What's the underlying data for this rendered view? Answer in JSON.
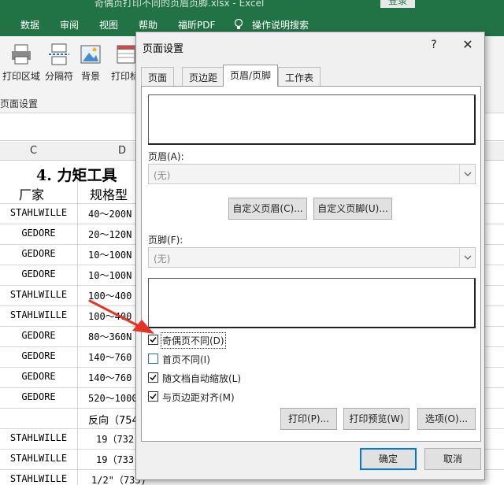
{
  "window": {
    "title": "奇偶页打印不同的页眉页脚.xlsx  -  Excel",
    "login": "登录"
  },
  "ribbon_tabs": [
    "数据",
    "审阅",
    "视图",
    "帮助",
    "福昕PDF",
    "操作说明搜索"
  ],
  "ribbon_buttons": [
    "打印区域",
    "分隔符",
    "背景",
    "打印标"
  ],
  "ribbon_group_label": "页面设置",
  "columns": [
    "C",
    "D"
  ],
  "sheet": {
    "title": "4. 力矩工具",
    "header_c": "厂家",
    "header_d": "规格型",
    "rows": [
      {
        "c": "STAHLWILLE",
        "d": "40～200N"
      },
      {
        "c": "GEDORE",
        "d": "20～120N"
      },
      {
        "c": "GEDORE",
        "d": "10～100N"
      },
      {
        "c": "GEDORE",
        "d": "10～100N"
      },
      {
        "c": "STAHLWILLE",
        "d": "100～400"
      },
      {
        "c": "STAHLWILLE",
        "d": "100～400"
      },
      {
        "c": "GEDORE",
        "d": "80～360N"
      },
      {
        "c": "GEDORE",
        "d": "140～760"
      },
      {
        "c": "GEDORE",
        "d": "140～760"
      },
      {
        "c": "GEDORE",
        "d": "520～1000"
      },
      {
        "c": "",
        "d": "反向（754"
      },
      {
        "c": "STAHLWILLE",
        "d": "19（732"
      },
      {
        "c": "STAHLWILLE",
        "d": "19（733"
      },
      {
        "c": "STAHLWILLE",
        "d": "1/2\"（735)"
      }
    ]
  },
  "dialog": {
    "title": "页面设置",
    "help": "?",
    "close": "✕",
    "tabs": [
      "页面",
      "页边距",
      "页眉/页脚",
      "工作表"
    ],
    "active_tab": "页眉/页脚",
    "header_label": "页眉(A):",
    "header_value": "(无)",
    "custom_header": "自定义页眉(C)...",
    "custom_footer": "自定义页脚(U)...",
    "footer_label": "页脚(F):",
    "footer_value": "(无)",
    "checkboxes": [
      {
        "label": "奇偶页不同(D)",
        "checked": true
      },
      {
        "label": "首页不同(I)",
        "checked": false
      },
      {
        "label": "随文档自动缩放(L)",
        "checked": true
      },
      {
        "label": "与页边距对齐(M)",
        "checked": true
      }
    ],
    "print": "打印(P)...",
    "print_preview": "打印预览(W)",
    "options": "选项(O)...",
    "ok": "确定",
    "cancel": "取消"
  },
  "colors": {
    "excel_green": "#217346",
    "dialog_bg": "#f0f0f0",
    "focus_blue": "#0078d7",
    "annotation_red": "#e53325"
  }
}
